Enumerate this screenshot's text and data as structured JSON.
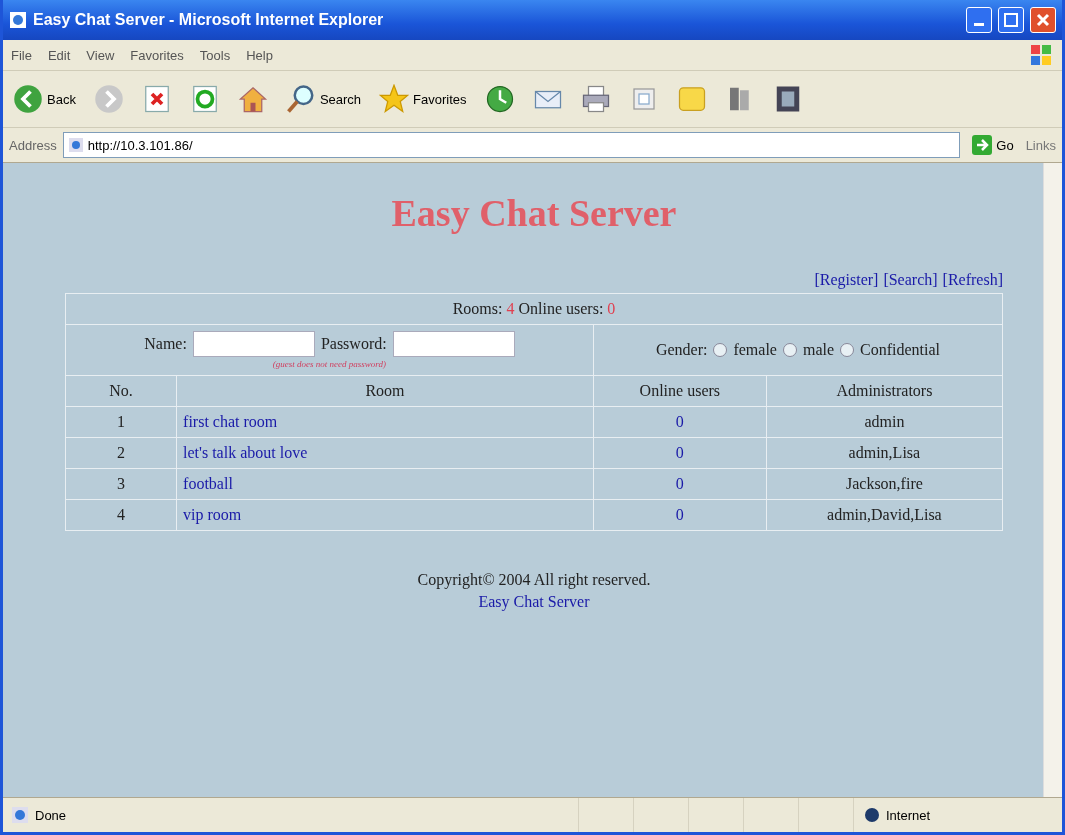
{
  "window": {
    "title": "Easy Chat Server - Microsoft Internet Explorer"
  },
  "menu": [
    "File",
    "Edit",
    "View",
    "Favorites",
    "Tools",
    "Help"
  ],
  "toolbar": [
    {
      "kind": "back",
      "label": "Back"
    },
    {
      "kind": "forward"
    },
    {
      "kind": "stop"
    },
    {
      "kind": "refresh"
    },
    {
      "kind": "home"
    },
    {
      "kind": "search",
      "label": "Search"
    },
    {
      "kind": "favorites",
      "label": "Favorites"
    },
    {
      "kind": "history"
    },
    {
      "kind": "mail"
    },
    {
      "kind": "print"
    },
    {
      "kind": "edit"
    },
    {
      "kind": "note"
    },
    {
      "kind": "research"
    },
    {
      "kind": "messenger"
    }
  ],
  "address": {
    "label": "Address",
    "value": "http://10.3.101.86/",
    "go": "Go",
    "links": "Links"
  },
  "page": {
    "heading": "Easy Chat Server",
    "links": [
      "[Register]",
      "[Search]",
      "[Refresh]"
    ],
    "stats": [
      {
        "label": "Rooms:",
        "value": "4"
      },
      {
        "label": "Online users:",
        "value": "0"
      }
    ],
    "name_label": "Name:",
    "password_label": "Password:",
    "password_hint": "(guest does not need password)",
    "gender_label": "Gender:",
    "genders": [
      {
        "label": "female",
        "selected": false
      },
      {
        "label": "male",
        "selected": false
      },
      {
        "label": "Confidential",
        "selected": false
      }
    ],
    "columns": [
      "No.",
      "Room",
      "Online users",
      "Administrators"
    ],
    "rows": [
      {
        "no": "1",
        "room": "first chat room",
        "online": "0",
        "admins": "admin"
      },
      {
        "no": "2",
        "room": "let's talk about love",
        "online": "0",
        "admins": "admin,Lisa"
      },
      {
        "no": "3",
        "room": "football",
        "online": "0",
        "admins": "Jackson,fire"
      },
      {
        "no": "4",
        "room": "vip room",
        "online": "0",
        "admins": "admin,David,Lisa"
      }
    ],
    "copyright": "Copyright© 2004 All right reserved.",
    "footer_link": "Easy Chat Server"
  },
  "status_bar": {
    "text": "Done",
    "zone": "Internet"
  }
}
